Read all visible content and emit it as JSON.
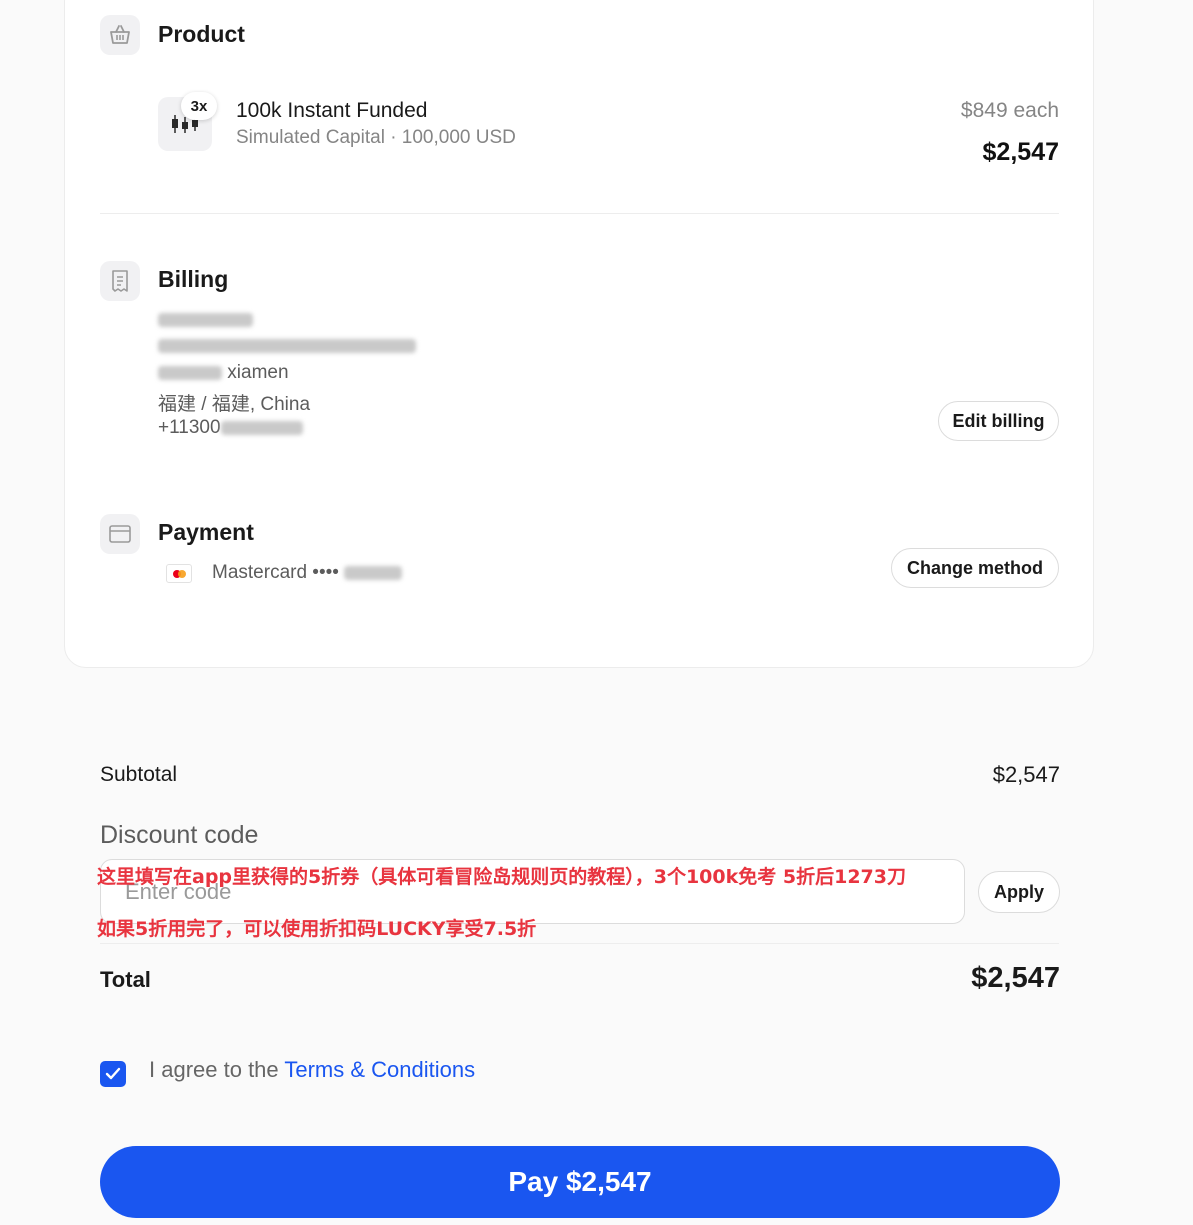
{
  "product": {
    "section_title": "Product",
    "quantity_badge": "3x",
    "name": "100k Instant Funded",
    "subtitle": "Simulated Capital · 100,000 USD",
    "price_each": "$849 each",
    "line_total": "$2,547"
  },
  "billing": {
    "section_title": "Billing",
    "city_line": "xiamen",
    "region_line": "福建 / 福建, China",
    "phone_prefix": "+11300",
    "edit_label": "Edit billing"
  },
  "payment": {
    "section_title": "Payment",
    "card_text": "Mastercard ••••",
    "change_label": "Change method"
  },
  "summary": {
    "subtotal_label": "Subtotal",
    "subtotal_value": "$2,547",
    "discount_label": "Discount code",
    "discount_placeholder": "Enter code",
    "apply_label": "Apply",
    "total_label": "Total",
    "total_value": "$2,547"
  },
  "annotations": {
    "line1": "这里填写在app里获得的5折券（具体可看冒险岛规则页的教程），3个100k免考 5折后1273刀",
    "line2": "如果5折用完了，可以使用折扣码LUCKY享受7.5折"
  },
  "agreement": {
    "prefix": "I agree to the ",
    "terms_link": "Terms & Conditions",
    "checked": true
  },
  "pay_button": "Pay $2,547",
  "colors": {
    "accent": "#1a56f0",
    "annotation": "#e8343f"
  }
}
